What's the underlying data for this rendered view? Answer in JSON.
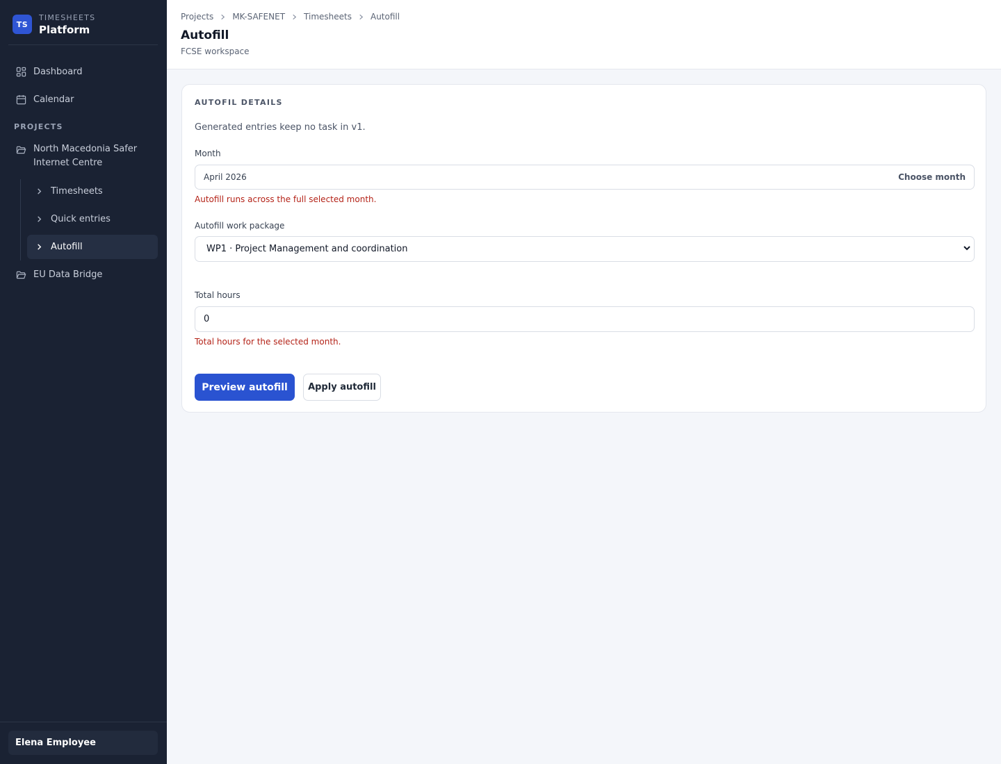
{
  "app": {
    "badge": "TS",
    "kicker": "TIMESHEETS",
    "title": "Platform"
  },
  "sidebar": {
    "nav": [
      {
        "label": "Dashboard",
        "icon": "dashboard-icon"
      },
      {
        "label": "Calendar",
        "icon": "calendar-icon"
      }
    ],
    "projects_label": "PROJECTS",
    "projects": [
      {
        "label": "North Macedonia Safer Internet Centre",
        "icon": "folder-open-icon",
        "children": [
          {
            "label": "Timesheets",
            "active": false
          },
          {
            "label": "Quick entries",
            "active": false
          },
          {
            "label": "Autofill",
            "active": true
          }
        ]
      },
      {
        "label": "EU Data Bridge",
        "icon": "folder-open-icon"
      }
    ],
    "user": "Elena Employee"
  },
  "header": {
    "breadcrumb": [
      "Projects",
      "MK-SAFENET",
      "Timesheets",
      "Autofill"
    ],
    "title": "Autofill",
    "subtitle": "FCSE workspace"
  },
  "form": {
    "heading": "AUTOFIL DETAILS",
    "description": "Generated entries keep no task in v1.",
    "month": {
      "label": "Month",
      "value": "April 2026",
      "action": "Choose month",
      "hint": "Autofill runs across the full selected month."
    },
    "work_package": {
      "label": "Autofill work package",
      "value": "WP1 · Project Management and coordination"
    },
    "total_hours": {
      "label": "Total hours",
      "value": "0",
      "hint": "Total hours for the selected month."
    },
    "preview_label": "Preview autofill",
    "apply_label": "Apply autofill"
  },
  "colors": {
    "sidebar_bg": "#1a2233",
    "accent": "#2a53d1",
    "error": "#b42318",
    "page_bg": "#f4f6fa"
  }
}
